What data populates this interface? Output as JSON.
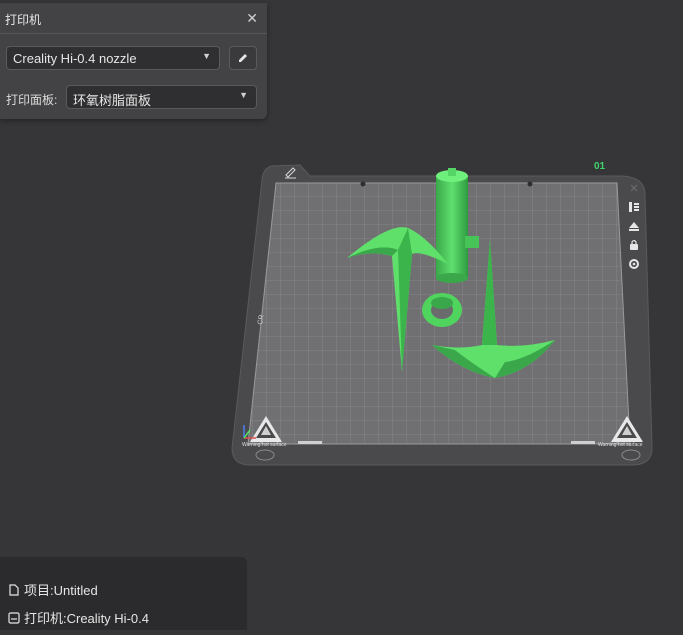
{
  "printer_panel": {
    "title": "打印机",
    "printer_select": "Creality Hi-0.4 nozzle",
    "plate_label": "打印面板:",
    "plate_select": "环氧树脂面板"
  },
  "viewport": {
    "plate_number": "01",
    "warning_text_left": "Warning!hot surface",
    "warning_text_right": "Warning!hot surface",
    "accent_color": "#4ee15a",
    "icons": [
      "edit-plate-icon",
      "arrange-icon",
      "orient-icon",
      "lock-icon",
      "settings-icon"
    ]
  },
  "info": {
    "project_label": "项目:Untitled",
    "printer_label": "打印机:Creality Hi-0.4"
  }
}
